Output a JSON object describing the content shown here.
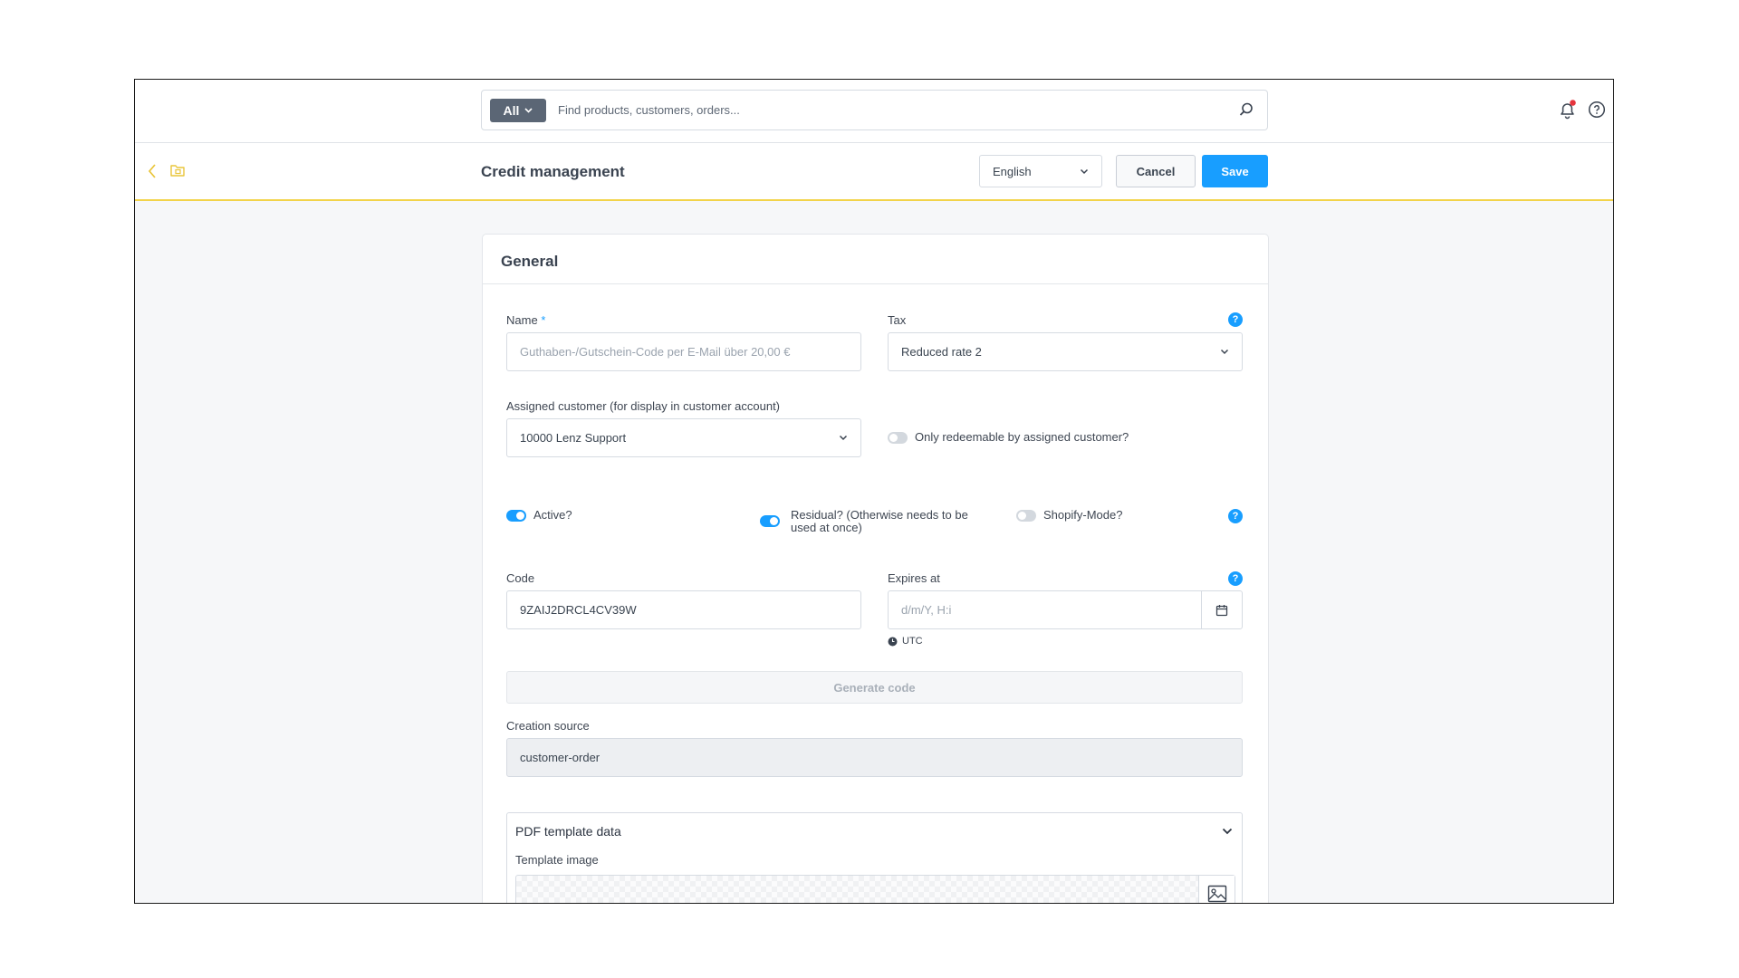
{
  "search": {
    "scope_label": "All",
    "placeholder": "Find products, customers, orders..."
  },
  "header": {
    "title": "Credit management",
    "language": "English",
    "cancel_label": "Cancel",
    "save_label": "Save"
  },
  "general": {
    "title": "General",
    "name": {
      "label": "Name",
      "required_mark": "*",
      "placeholder": "Guthaben-/Gutschein-Code per E-Mail über 20,00 €"
    },
    "tax": {
      "label": "Tax",
      "value": "Reduced rate 2"
    },
    "assigned_customer": {
      "label": "Assigned customer (for display in customer account)",
      "value": "10000 Lenz Support"
    },
    "toggles": {
      "only_redeemable": {
        "label": "Only redeemable by assigned customer?",
        "on": false
      },
      "active": {
        "label": "Active?",
        "on": true
      },
      "residual": {
        "label_line1": "Residual? (Otherwise needs to be",
        "label_line2": "used at once)",
        "on": true
      },
      "shopify_mode": {
        "label": "Shopify-Mode?",
        "on": false
      }
    },
    "code": {
      "label": "Code",
      "value": "9ZAIJ2DRCL4CV39W"
    },
    "expires_at": {
      "label": "Expires at",
      "placeholder": "d/m/Y, H:i",
      "timezone": "UTC"
    },
    "generate_code_label": "Generate code",
    "creation_source": {
      "label": "Creation source",
      "value": "customer-order"
    },
    "pdf_template": {
      "title": "PDF template data",
      "template_image_label": "Template image"
    }
  },
  "colors": {
    "accent": "#189eff",
    "highlight_border": "#f2d34a",
    "notification_dot": "#e5343d"
  }
}
